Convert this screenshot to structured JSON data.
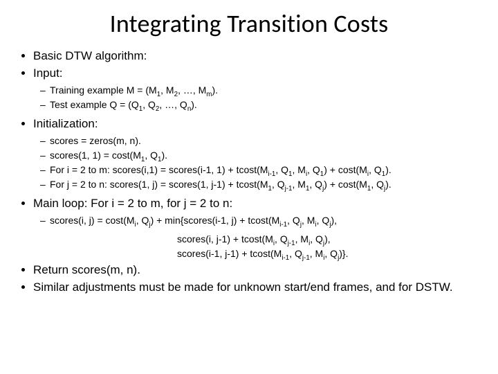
{
  "title": "Integrating Transition Costs",
  "b1": "Basic DTW algorithm:",
  "b2": "Input:",
  "b2a": "Training example M = (M<sub>1</sub>, M<sub>2</sub>, …, M<sub>m</sub>).",
  "b2b": "Test example Q = (Q<sub>1</sub>, Q<sub>2</sub>, …, Q<sub>n</sub>).",
  "b3": "Initialization:",
  "b3a": "scores = zeros(m, n).",
  "b3b": "scores(1, 1) = cost(M<sub>1</sub>, Q<sub>1</sub>).",
  "b3c": "For i = 2 to m: scores(i,1) = scores(i-1, 1) + tcost(M<sub>i-1</sub>, Q<sub>1</sub>, M<sub>i</sub>, Q<sub>1</sub>) + cost(M<sub>i</sub>, Q<sub>1</sub>).",
  "b3d": "For j = 2 to n: scores(1, j) = scores(1, j-1) + tcost(M<sub>1</sub>, Q<sub>j-1</sub>, M<sub>1</sub>, Q<sub>j</sub>) + cost(M<sub>1</sub>, Q<sub>j</sub>).",
  "b4": "Main loop: For i = 2 to m, for j = 2 to n:",
  "b4a": "scores(i, j) = cost(M<sub>i</sub>, Q<sub>j</sub>) + min{scores(i-1, j) + tcost(M<sub>i-1</sub>, Q<sub>j</sub>, M<sub>i</sub>, Q<sub>j</sub>),",
  "b4b": "scores(i, j-1) + tcost(M<sub>i</sub>, Q<sub>j-1</sub>, M<sub>i</sub>, Q<sub>j</sub>),",
  "b4c": "scores(i-1, j-1) +  tcost(M<sub>i-1</sub>, Q<sub>j-1</sub>, M<sub>i</sub>, Q<sub>j</sub>)}.",
  "b5": "Return scores(m, n).",
  "b6": "Similar adjustments must be made for unknown start/end frames, and for DSTW."
}
